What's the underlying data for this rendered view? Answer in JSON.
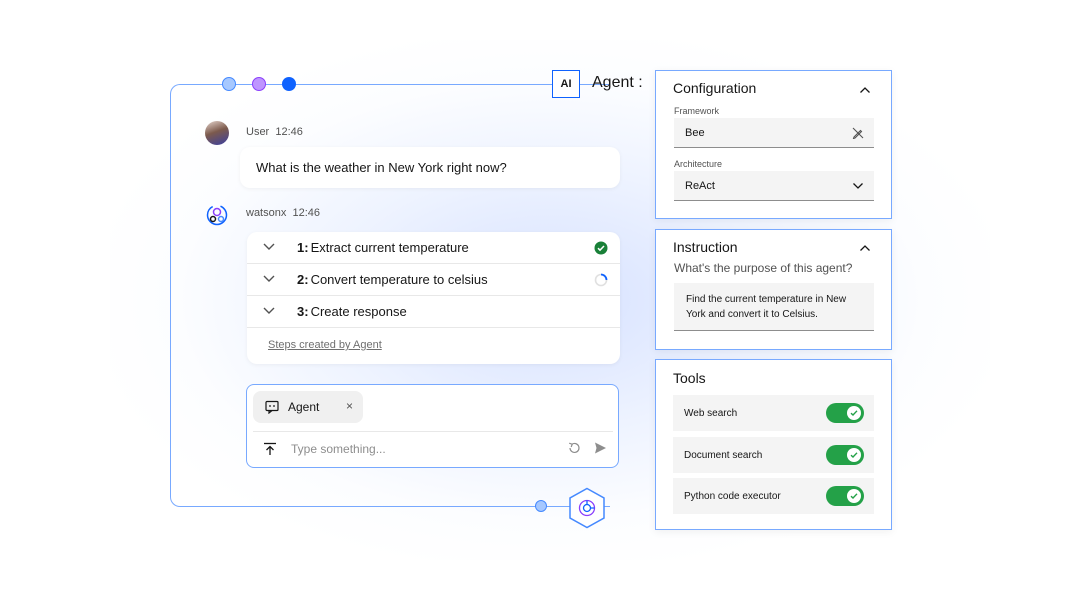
{
  "header": {
    "ai_badge": "AI",
    "title": "Agent :"
  },
  "chat": {
    "user": {
      "name": "User",
      "time": "12:46",
      "message": "What is the weather in New York right now?"
    },
    "assistant": {
      "name": "watsonx",
      "time": "12:46",
      "steps": [
        {
          "num": "1:",
          "label": "Extract current temperature",
          "status": "complete"
        },
        {
          "num": "2:",
          "label": "Convert temperature to celsius",
          "status": "in-progress"
        },
        {
          "num": "3:",
          "label": "Create response",
          "status": "pending"
        }
      ],
      "steps_link": "Steps created by Agent"
    }
  },
  "composer": {
    "chip_label": "Agent",
    "chip_close": "×",
    "placeholder": "Type something..."
  },
  "configuration": {
    "title": "Configuration",
    "framework_label": "Framework",
    "framework_value": "Bee",
    "architecture_label": "Architecture",
    "architecture_value": "ReAct"
  },
  "instruction": {
    "title": "Instruction",
    "question": "What's the purpose of this agent?",
    "text": "Find the current temperature in New York and convert it to Celsius."
  },
  "tools": {
    "title": "Tools",
    "items": [
      {
        "label": "Web search",
        "enabled": true
      },
      {
        "label": "Document search",
        "enabled": true
      },
      {
        "label": "Python code executor",
        "enabled": true
      }
    ]
  },
  "colors": {
    "accent": "#0f62fe",
    "frame": "#78a9ff",
    "toggle_on": "#24a148",
    "success": "#198038"
  }
}
